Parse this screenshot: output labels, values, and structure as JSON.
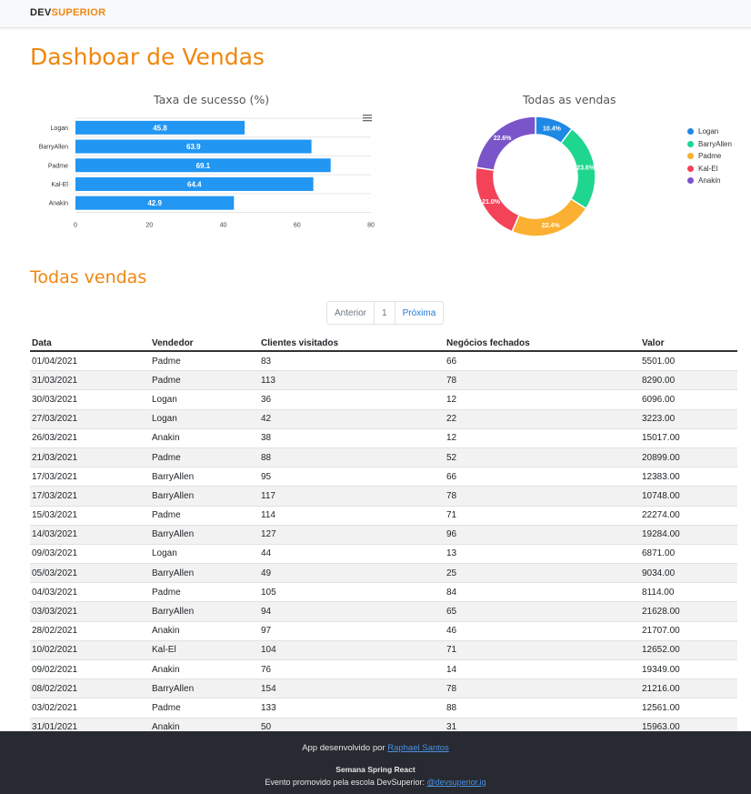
{
  "brand": {
    "part1": "DEV",
    "part2": "SUPERIOR"
  },
  "page_title": "Dashboar de Vendas",
  "colors": {
    "accent": "#f0860f",
    "bar": "#2196f3",
    "footer_bg": "#272a31"
  },
  "icons": {
    "chart_menu": "hamburger-menu-icon"
  },
  "chart_data": [
    {
      "type": "bar",
      "orientation": "horizontal",
      "title": "Taxa de sucesso (%)",
      "categories": [
        "Logan",
        "BarryAllen",
        "Padme",
        "Kal-El",
        "Anakin"
      ],
      "values": [
        45.8,
        63.9,
        69.1,
        64.4,
        42.9
      ],
      "xlim": [
        0,
        80
      ],
      "xticks": [
        "0",
        "20",
        "40",
        "60",
        "80"
      ],
      "xlabel": "",
      "ylabel": "",
      "grid": true
    },
    {
      "type": "pie",
      "donut": true,
      "title": "Todas as vendas",
      "labels": [
        "Logan",
        "BarryAllen",
        "Padme",
        "Kal-El",
        "Anakin"
      ],
      "values": [
        10.4,
        23.6,
        22.4,
        21.0,
        22.6
      ],
      "value_labels": [
        "10.4%",
        "23.6%",
        "22.4%",
        "21.0%",
        "22.6%"
      ],
      "colors": [
        "#1e88e5",
        "#1fd68f",
        "#fbb031",
        "#f44259",
        "#7a55c9"
      ],
      "legend": "right"
    }
  ],
  "section_title": "Todas vendas",
  "pagination": {
    "prev": "Anterior",
    "current": "1",
    "next": "Próxima"
  },
  "table": {
    "headers": [
      "Data",
      "Vendedor",
      "Clientes visitados",
      "Negócios fechados",
      "Valor"
    ],
    "rows": [
      [
        "01/04/2021",
        "Padme",
        "83",
        "66",
        "5501.00"
      ],
      [
        "31/03/2021",
        "Padme",
        "113",
        "78",
        "8290.00"
      ],
      [
        "30/03/2021",
        "Logan",
        "36",
        "12",
        "6096.00"
      ],
      [
        "27/03/2021",
        "Logan",
        "42",
        "22",
        "3223.00"
      ],
      [
        "26/03/2021",
        "Anakin",
        "38",
        "12",
        "15017.00"
      ],
      [
        "21/03/2021",
        "Padme",
        "88",
        "52",
        "20899.00"
      ],
      [
        "17/03/2021",
        "BarryAllen",
        "95",
        "66",
        "12383.00"
      ],
      [
        "17/03/2021",
        "BarryAllen",
        "117",
        "78",
        "10748.00"
      ],
      [
        "15/03/2021",
        "Padme",
        "114",
        "71",
        "22274.00"
      ],
      [
        "14/03/2021",
        "BarryAllen",
        "127",
        "96",
        "19284.00"
      ],
      [
        "09/03/2021",
        "Logan",
        "44",
        "13",
        "6871.00"
      ],
      [
        "05/03/2021",
        "BarryAllen",
        "49",
        "25",
        "9034.00"
      ],
      [
        "04/03/2021",
        "Padme",
        "105",
        "84",
        "8114.00"
      ],
      [
        "03/03/2021",
        "BarryAllen",
        "94",
        "65",
        "21628.00"
      ],
      [
        "28/02/2021",
        "Anakin",
        "97",
        "46",
        "21707.00"
      ],
      [
        "10/02/2021",
        "Kal-El",
        "104",
        "71",
        "12652.00"
      ],
      [
        "09/02/2021",
        "Anakin",
        "76",
        "14",
        "19349.00"
      ],
      [
        "08/02/2021",
        "BarryAllen",
        "154",
        "78",
        "21216.00"
      ],
      [
        "03/02/2021",
        "Padme",
        "133",
        "88",
        "12561.00"
      ],
      [
        "31/01/2021",
        "Anakin",
        "50",
        "31",
        "15963.00"
      ]
    ]
  },
  "footer": {
    "line1_prefix": "App desenvolvido por ",
    "line1_link": "Raphael Santos",
    "line2": "Semana Spring React",
    "line3_prefix": "Evento promovido pela escola DevSuperior: ",
    "line3_link": "@devsuperior.ig"
  }
}
